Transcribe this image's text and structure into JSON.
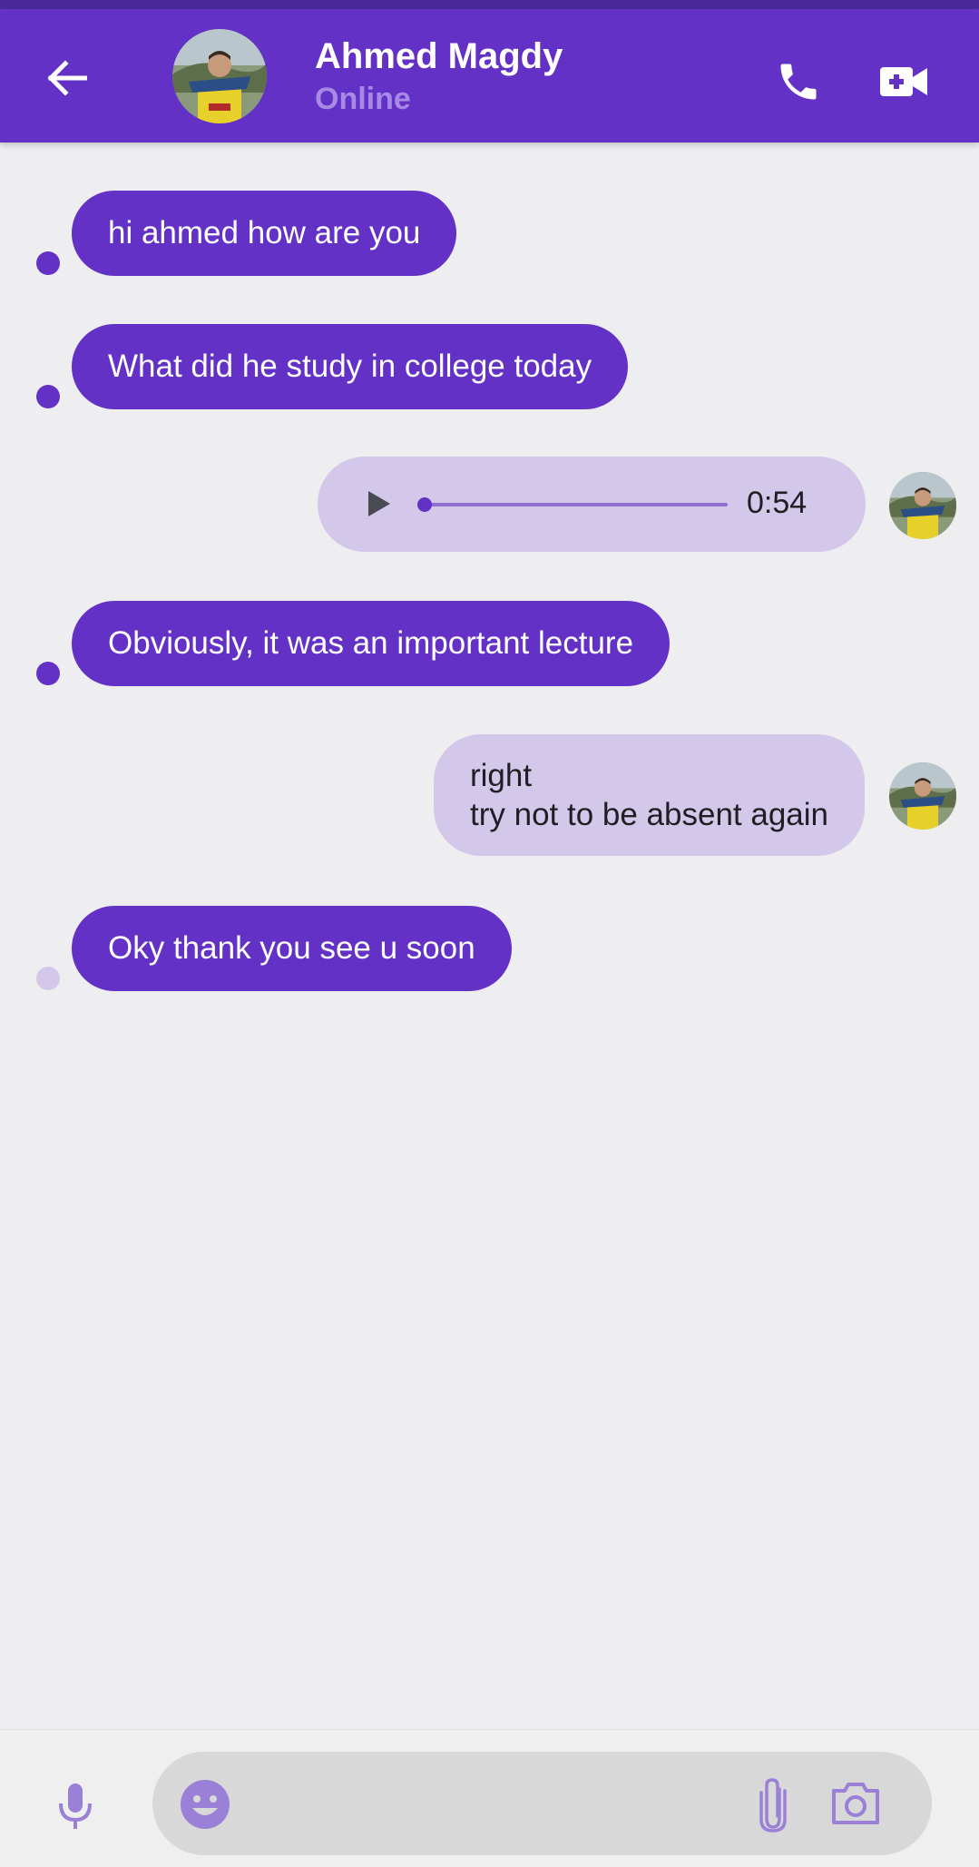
{
  "header": {
    "contact_name": "Ahmed Magdy",
    "contact_status": "Online",
    "icons": {
      "back": "arrow-left-icon",
      "call": "phone-icon",
      "video": "video-camera-icon"
    },
    "colors": {
      "bar": "#6331c6",
      "status": "#a88ae6"
    }
  },
  "messages": [
    {
      "direction": "incoming",
      "type": "text",
      "text": "hi ahmed how are you",
      "status": "sent"
    },
    {
      "direction": "incoming",
      "type": "text",
      "text": "What did he study in college today",
      "status": "sent"
    },
    {
      "direction": "outgoing",
      "type": "audio",
      "duration": "0:54",
      "progress": 0.0
    },
    {
      "direction": "incoming",
      "type": "text",
      "text": "Obviously, it was an important lecture",
      "status": "sent"
    },
    {
      "direction": "outgoing",
      "type": "text",
      "lines": [
        "right",
        "try not to be absent again"
      ]
    },
    {
      "direction": "incoming",
      "type": "text",
      "text": "Oky thank you see u soon",
      "status": "pending"
    }
  ],
  "composer": {
    "placeholder": "",
    "icons": {
      "mic": "microphone-icon",
      "emoji": "emoji-icon",
      "attach": "paperclip-icon",
      "camera": "camera-icon"
    }
  },
  "colors": {
    "accent": "#6331c6",
    "outgoing_bubble": "#d4c8ea",
    "background": "#eeeef0"
  }
}
